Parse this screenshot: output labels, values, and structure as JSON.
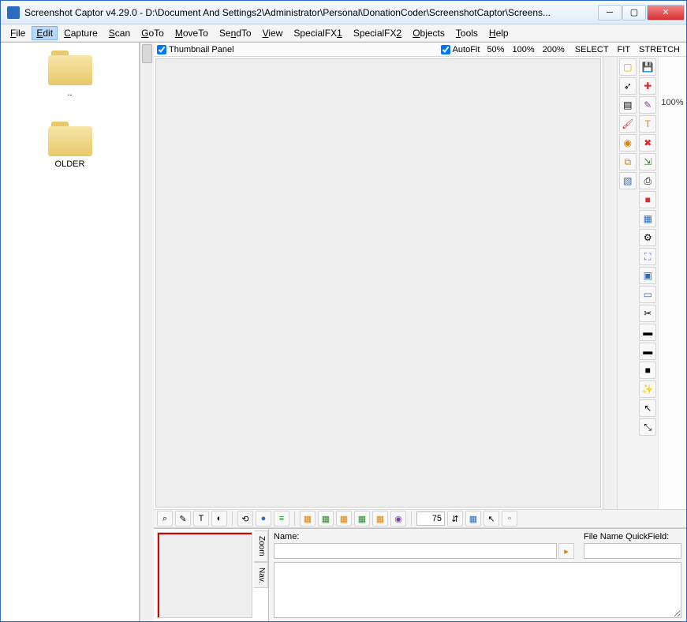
{
  "window": {
    "title": "Screenshot Captor v4.29.0 - D:\\Document And Settings2\\Administrator\\Personal\\DonationCoder\\ScreenshotCaptor\\Screens..."
  },
  "menu": {
    "items": [
      "File",
      "Edit",
      "Capture",
      "Scan",
      "GoTo",
      "MoveTo",
      "SendTo",
      "View",
      "SpecialFX1",
      "SpecialFX2",
      "Objects",
      "Tools",
      "Help"
    ],
    "underlines": [
      "F",
      "E",
      "C",
      "S",
      "G",
      "M",
      "n",
      "V",
      "1",
      "2",
      "O",
      "T",
      "H"
    ],
    "active": "Edit"
  },
  "panel": {
    "thumbnail_label": "Thumbnail Panel",
    "autofit_label": "AutoFit",
    "zoom_levels": [
      "50%",
      "100%",
      "200%"
    ],
    "fit_opts": [
      "SELECT",
      "FIT",
      "STRETCH"
    ]
  },
  "folders": [
    {
      "label": ".."
    },
    {
      "label": "OLDER"
    }
  ],
  "right_col1": [
    {
      "n": "highlight-icon",
      "g": "▢",
      "c": "c-yel"
    },
    {
      "n": "arrow-icon",
      "g": "➶",
      "c": ""
    },
    {
      "n": "text-box-icon",
      "g": "▤",
      "c": ""
    },
    {
      "n": "brush-icon",
      "g": "🖌",
      "c": "c-red"
    },
    {
      "n": "blur-icon",
      "g": "◉",
      "c": "c-org"
    },
    {
      "n": "copy-icon",
      "g": "⧉",
      "c": "c-org"
    },
    {
      "n": "image-icon",
      "g": "▧",
      "c": "c-blu"
    }
  ],
  "right_col2": [
    {
      "n": "save-icon",
      "g": "💾",
      "c": "c-blu"
    },
    {
      "n": "add-icon",
      "g": "✚",
      "c": "c-red"
    },
    {
      "n": "edit-icon",
      "g": "✎",
      "c": "c-pur"
    },
    {
      "n": "text-icon",
      "g": "T",
      "c": "c-org"
    },
    {
      "n": "delete-icon",
      "g": "✖",
      "c": "c-red"
    },
    {
      "n": "export-icon",
      "g": "⇲",
      "c": "c-grn"
    },
    {
      "n": "print-icon",
      "g": "⎙",
      "c": ""
    },
    {
      "n": "box-icon",
      "g": "■",
      "c": "c-red"
    },
    {
      "n": "photo-icon",
      "g": "▦",
      "c": "c-blu"
    },
    {
      "n": "link-icon",
      "g": "⚙",
      "c": ""
    },
    {
      "n": "expand-icon",
      "g": "⛶",
      "c": "c-blu"
    },
    {
      "n": "select-icon",
      "g": "▣",
      "c": "c-blu"
    },
    {
      "n": "region-icon",
      "g": "▭",
      "c": "c-blu"
    },
    {
      "n": "crop-icon",
      "g": "✂",
      "c": ""
    },
    {
      "n": "panel1-icon",
      "g": "▬",
      "c": ""
    },
    {
      "n": "panel2-icon",
      "g": "▬",
      "c": ""
    },
    {
      "n": "panel3-icon",
      "g": "■",
      "c": ""
    },
    {
      "n": "wand-icon",
      "g": "✨",
      "c": "c-org"
    },
    {
      "n": "cursor-icon",
      "g": "↖",
      "c": ""
    },
    {
      "n": "resize-icon",
      "g": "⤡",
      "c": ""
    }
  ],
  "far_right_label": "100%",
  "bottom_toolbar": {
    "group1": [
      {
        "n": "scanner-icon",
        "g": "⌕"
      },
      {
        "n": "scan2-icon",
        "g": "✎"
      },
      {
        "n": "ocr-icon",
        "g": "T"
      },
      {
        "n": "globe-icon",
        "g": "◐"
      }
    ],
    "group2": [
      {
        "n": "rotate-icon",
        "g": "⟲"
      },
      {
        "n": "web-icon",
        "g": "●",
        "c": "c-blu"
      },
      {
        "n": "list-icon",
        "g": "≡",
        "c": "c-grn"
      }
    ],
    "group3": [
      {
        "n": "fx1-icon",
        "g": "▦",
        "c": "c-org"
      },
      {
        "n": "fx2-icon",
        "g": "▦",
        "c": "c-grn"
      },
      {
        "n": "fx3-icon",
        "g": "▦",
        "c": "c-org"
      },
      {
        "n": "fx4-icon",
        "g": "▦",
        "c": "c-grn"
      },
      {
        "n": "fx5-icon",
        "g": "▦",
        "c": "c-org"
      },
      {
        "n": "color-icon",
        "g": "◉",
        "c": "c-pur"
      }
    ],
    "spinner_value": "75",
    "group4": [
      {
        "n": "stepper-icon",
        "g": "⇵"
      },
      {
        "n": "grid-icon",
        "g": "▦",
        "c": "c-blu"
      },
      {
        "n": "pointer-icon",
        "g": "↖"
      },
      {
        "n": "pdf-icon",
        "g": "▫",
        "c": "c-red"
      }
    ]
  },
  "zoom_nav": {
    "tab1": "Zoom",
    "tab2": "Nav."
  },
  "info": {
    "name_label": "Name:",
    "quickfield_label": "File Name QuickField:",
    "name_value": "",
    "quickfield_value": "",
    "notes_value": ""
  }
}
